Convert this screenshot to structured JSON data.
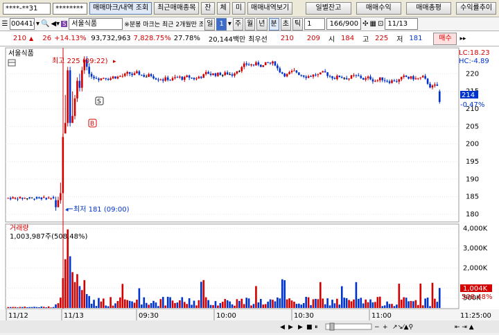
{
  "toolbar1": {
    "account": "****-**31",
    "password": "********",
    "tab_trades": "매매마크/내역 조회",
    "tab_recent": "최근매매종목",
    "tab_balance": "잔",
    "tab_filled": "체",
    "tab_unfilled": "미",
    "tab_history": "매매내역보기",
    "btn_daily": "일별잔고",
    "btn_profit": "매매수익",
    "btn_summary": "매매총평",
    "btn_rate": "수익률추이"
  },
  "toolbar2": {
    "stock_code": "004410",
    "stock_name": "서울식품",
    "notice": "※분봉 마크는 최근 2개월만 조회",
    "period_day": "일",
    "period_num": "1",
    "period_week": "주",
    "period_month": "월",
    "period_year": "년",
    "period_min": "분",
    "period_sec": "초",
    "period_tick": "틱",
    "tick_value": "1",
    "count": "166/900",
    "date": "11/13"
  },
  "toolbar3": {
    "price": "210",
    "change": "26",
    "change_rate": "+14.13%",
    "volume": "93,732,963",
    "volume_rate": "7,828.75%",
    "turnover": "27.78%",
    "amount": "20,144백만",
    "best_label": "최우선",
    "best_ask": "210",
    "best_bid": "209",
    "open_label": "시",
    "open": "184",
    "high_label": "고",
    "high": "225",
    "low_label": "저",
    "low": "181",
    "trade_btn": "매수"
  },
  "price_panel": {
    "title": "서울식품",
    "high_note": "최고 225 (09:22)",
    "low_note": "최저 181 (09:00)",
    "lc": "LC:18.23",
    "hc": "HC:-4.89",
    "current": "214",
    "current_rate": "-0.47%",
    "mark_sell": "S",
    "mark_buy": "B",
    "y_ticks": [
      "220",
      "215",
      "210",
      "205",
      "200",
      "195",
      "190",
      "185",
      "180"
    ]
  },
  "volume_panel": {
    "title": "거래량",
    "summary": "1,003,987주(508.48%)",
    "current": "1,004K",
    "current_rate": "508.48%",
    "y_ticks": [
      "4,000K",
      "3,000K",
      "2,000K",
      "1,000K",
      "500K"
    ]
  },
  "x_axis": {
    "labels": [
      "11/12",
      "11/13",
      "09:30",
      "10:00",
      "10:30",
      "11:00"
    ],
    "end_time": "11:25:00"
  },
  "chart_data": {
    "type": "candlestick",
    "y_range": [
      178,
      227
    ],
    "volume_range": [
      0,
      4150
    ],
    "volume_unit": "K",
    "colors": {
      "up": "#d40000",
      "down": "#0033cc",
      "flat": "#000000"
    }
  }
}
